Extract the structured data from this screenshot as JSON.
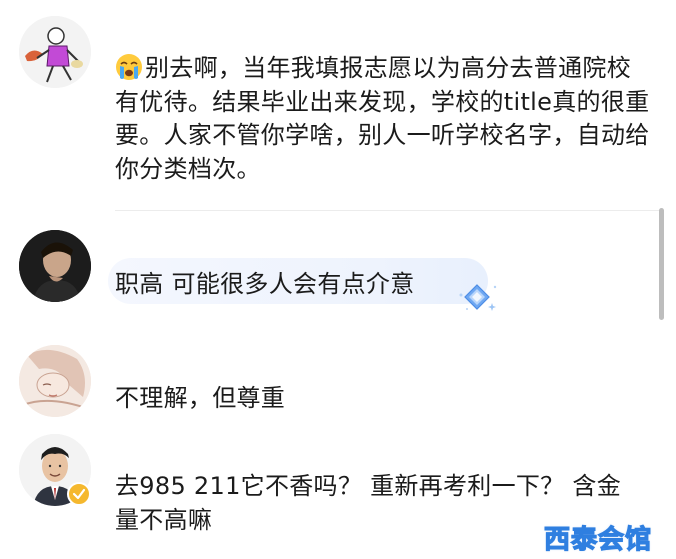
{
  "comments": [
    {
      "avatar": "cartoon-figure-avatar",
      "text": "别去啊，当年我填报志愿以为高分去普通院校有优待。结果毕业出来发现，学校的title真的很重要。人家不管你学啥，别人一听学校名字，自动给你分类档次。",
      "emoji": "crying-face-emoji"
    },
    {
      "avatar": "man-portrait-avatar",
      "text": "职高 可能很多人会有点介意",
      "badge": "diamond-sparkle-icon"
    },
    {
      "avatar": "woman-sketch-avatar",
      "text": "不理解，但尊重"
    },
    {
      "avatar": "man-suit-avatar",
      "text": "去985 211它不香吗？ 重新再考利一下？ 含金量不高嘛",
      "verified": "verified-badge-icon"
    }
  ],
  "watermark": "西泰会馆",
  "colors": {
    "pill_bg": "#eef3fd",
    "watermark_stroke": "#2f7fe0",
    "verified": "#f5b82e",
    "scrollbar": "#bdbdbd"
  }
}
